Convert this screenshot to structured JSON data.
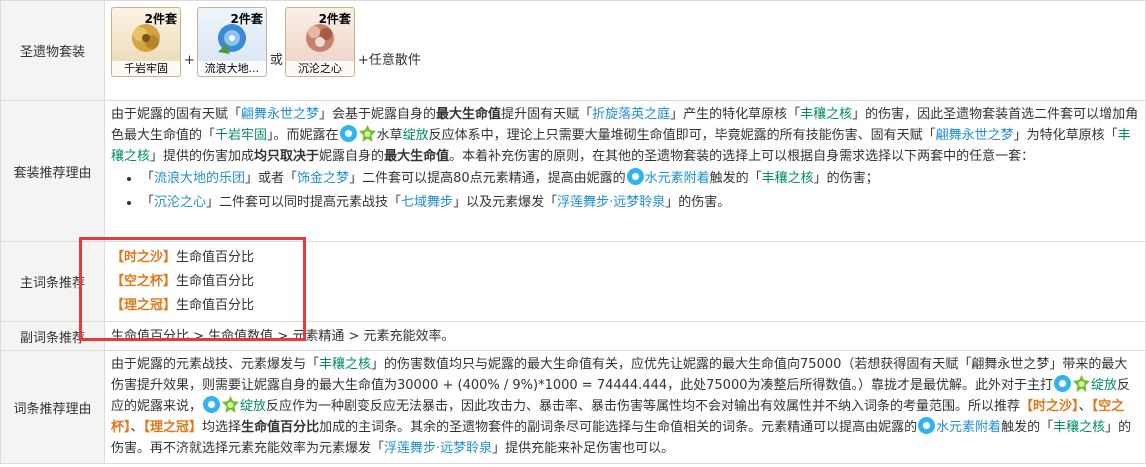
{
  "rows": {
    "set": {
      "label": "圣遗物套装",
      "cards": [
        {
          "pieces": "2件套",
          "name": "千岩牢固",
          "color": "#c99a3a"
        },
        {
          "pieces": "2件套",
          "name": "流浪大地...",
          "color": "#3a8ad6"
        },
        {
          "pieces": "2件套",
          "name": "沉沦之心",
          "color": "#b5684a"
        }
      ],
      "plus1": "+",
      "or": "或",
      "tail": "+任意散件"
    },
    "reason": {
      "label": "套装推荐理由",
      "p1": "由于妮露的固有天赋「",
      "t1": "翩舞永世之梦",
      "p2": "」会基于妮露自身的",
      "b1": "最大生命值",
      "p3": "提升固有天赋「",
      "t2": "折旋落英之庭",
      "p4": "」产生的特化草原核「",
      "t3": "丰穰之核",
      "p5": "」的伤害，因此圣遗物套装首选二件套可以增加角色最大生命值的「",
      "t4": "千岩牢固",
      "p6": "」。而妮露在",
      "p7": "水草",
      "t5": "绽放",
      "p8": "反应体系中，理论上只需要大量堆砌生命值即可，毕竟妮露的所有技能伤害、固有天赋「",
      "t6": "翩舞永世之梦",
      "p9": "」为特化草原核「",
      "t7": "丰穰之核",
      "p10": "」提供的伤害加成",
      "b2": "均只取决于",
      "p11": "妮露自身的",
      "b3": "最大生命值",
      "p12": "。本着补充伤害的原则，在其他的圣遗物套装的选择上可以根据自身需求选择以下两套中的任意一套：",
      "li1_a": "「",
      "li1_t1": "流浪大地的乐团",
      "li1_b": "」或者「",
      "li1_t2": "饰金之梦",
      "li1_c": "」二件套可以提高80点元素精通，提高由妮露的",
      "li1_t3": "水元素附着",
      "li1_d": "触发的「",
      "li1_t4": "丰穰之核",
      "li1_e": "」的伤害；",
      "li2_a": "「",
      "li2_t1": "沉沦之心",
      "li2_b": "」二件套可以同时提高元素战技「",
      "li2_t2": "七域舞步",
      "li2_c": "」以及元素爆发「",
      "li2_t3": "浮莲舞步·远梦聆泉",
      "li2_d": "」的伤害。"
    },
    "main": {
      "label": "主词条推荐",
      "items": [
        {
          "slot": "【时之沙】",
          "stat": "生命值百分比"
        },
        {
          "slot": "【空之杯】",
          "stat": "生命值百分比"
        },
        {
          "slot": "【理之冠】",
          "stat": "生命值百分比"
        }
      ]
    },
    "sub": {
      "label": "副词条推荐",
      "text": "生命值百分比 > 生命值数值 > 元素精通 > 元素充能效率。"
    },
    "subreason": {
      "label": "词条推荐理由",
      "q1": "由于妮露的元素战技、元素爆发与「",
      "t1": "丰穰之核",
      "q2": "」的伤害数值均只与妮露的最大生命值有关，应优先让妮露的最大生命值向75000（若想获得固有天赋「翩舞永世之梦」带来的最大伤害提升效果，则需要让妮露自身的最大生命值为30000 + (400% / 9%)*1000 = 74444.444，此处75000为凑整后所得数值。）靠拢才是最优解。此外对于主打",
      "t2": "绽放",
      "q3": "反应的妮露来说，",
      "t3": "绽放",
      "q4": "反应作为一种剧变反应无法暴击，因此攻击力、暴击率、暴击伤害等属性均不会对输出有效属性并不纳入词条的考量范围。所以推荐",
      "o1": "【时之沙】",
      "q5": "、",
      "o2": "【空之杯】",
      "q6": "、",
      "o3": "【理之冠】",
      "q7": "均选择",
      "b1": "生命值百分比",
      "q8": "加成的主词条。其余的圣遗物套件的副词条尽可能选择与生命值相关的词条。元素精通可以提高由妮露的",
      "t4": "水元素附着",
      "q9": "触发的「",
      "t5": "丰穰之核",
      "q10": "」的伤害。再不济就选择元素充能效率为元素爆发「",
      "t6": "浮莲舞步·远梦聆泉",
      "q11": "」提供充能来补足伤害也可以。"
    }
  },
  "icons": {
    "hydro": "hydro-element-icon",
    "dendro": "dendro-element-icon"
  },
  "colors": {
    "link": "#1f8fd2",
    "term": "#008c62",
    "slot": "#e0781d",
    "highlight": "#e83a3a"
  }
}
